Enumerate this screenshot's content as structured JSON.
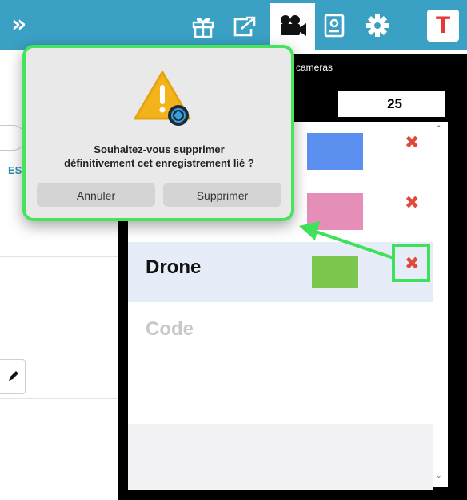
{
  "topbar": {
    "icons": [
      "chevron-double-right-icon",
      "gift-icon",
      "share-export-icon",
      "video-camera-icon",
      "id-badge-icon",
      "gear-icon"
    ],
    "avatar_letter": "T"
  },
  "background": {
    "tab_fragment": "ES"
  },
  "panel": {
    "title_fragment": "cameras",
    "count": "25",
    "rows": [
      {
        "label": "",
        "color": "#5b8ff0"
      },
      {
        "label": "",
        "color": "#e58fb8"
      },
      {
        "label": "Drone",
        "color": "#7cc84f"
      },
      {
        "label": "Code",
        "color": ""
      }
    ]
  },
  "dialog": {
    "message_line1": "Souhaitez-vous supprimer",
    "message_line2": "définitivement cet enregistrement lié ?",
    "cancel_label": "Annuler",
    "confirm_label": "Supprimer"
  },
  "colors": {
    "topbar": "#3aa0c4",
    "highlight": "#3fe05a",
    "delete": "#e04a3a"
  }
}
